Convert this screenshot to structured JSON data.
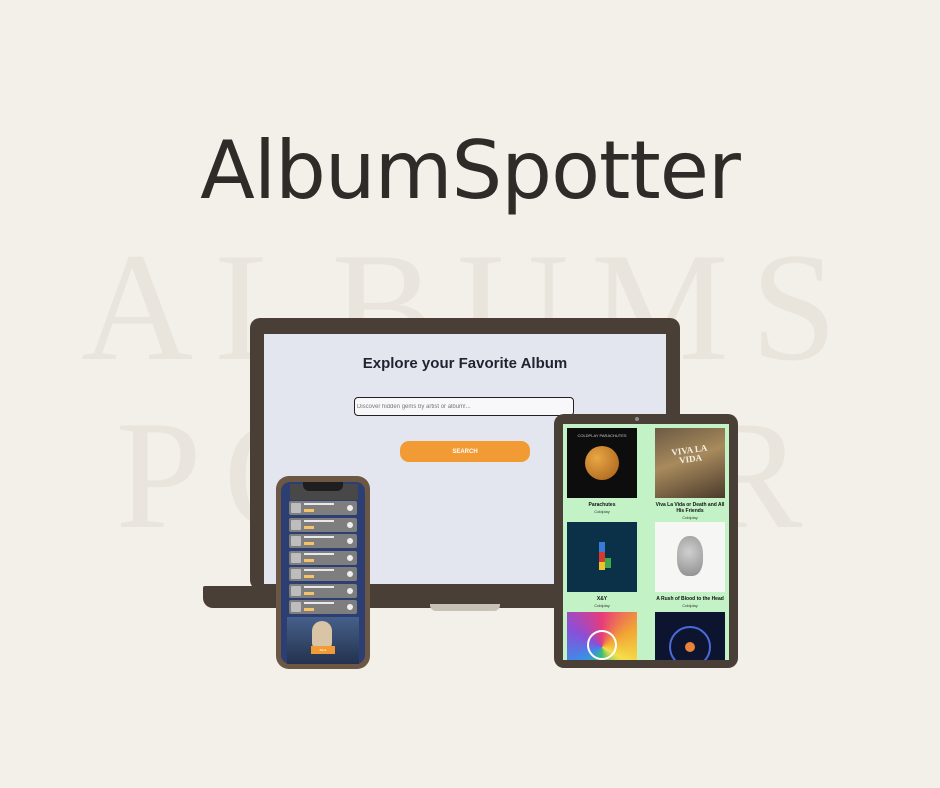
{
  "brand": {
    "title": "AlbumSpotter"
  },
  "watermark": {
    "line1": "ALBUMS",
    "line2": "POSTER"
  },
  "laptop": {
    "heading": "Explore your Favorite Album",
    "search": {
      "placeholder": "Discover hidden gems by artist or album!...",
      "value": ""
    },
    "search_button": "SEARCH"
  },
  "phone": {
    "rows": 8,
    "button_label": "Back"
  },
  "tablet": {
    "albums": [
      {
        "name": "Parachutes",
        "artist": "Coldplay",
        "cover_text": "COLDPLAY  PARACHUTES"
      },
      {
        "name": "Viva La Vida or Death and All His Friends",
        "artist": "Coldplay",
        "cover_text": "VIVA LA VIDA"
      },
      {
        "name": "X&Y",
        "artist": "Coldplay"
      },
      {
        "name": "A Rush of Blood to the Head",
        "artist": "Coldplay"
      },
      {
        "name": "",
        "artist": ""
      },
      {
        "name": "",
        "artist": ""
      }
    ]
  },
  "colors": {
    "background": "#f3f0ea",
    "accent": "#f29a33",
    "device_frame": "#4a3f36",
    "tablet_bg": "#c3f2c6",
    "laptop_screen": "#e4e6ef"
  }
}
